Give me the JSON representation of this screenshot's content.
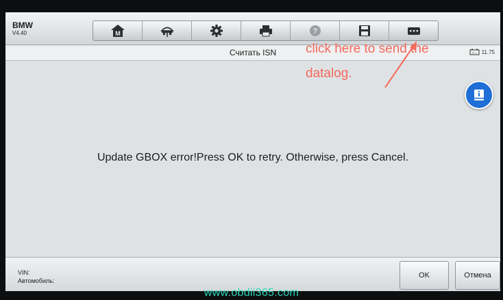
{
  "header": {
    "brand": "BMW",
    "version": "V4.40"
  },
  "toolbar": {
    "buttons": [
      {
        "name": "home",
        "icon": "home-m-icon"
      },
      {
        "name": "vehicle",
        "icon": "car-lift-icon"
      },
      {
        "name": "settings",
        "icon": "gear-icon"
      },
      {
        "name": "print",
        "icon": "printer-icon"
      },
      {
        "name": "help",
        "icon": "help-icon"
      },
      {
        "name": "save",
        "icon": "floppy-icon"
      },
      {
        "name": "datalog",
        "icon": "datalog-icon"
      }
    ]
  },
  "title_bar": {
    "title": "Считать ISN",
    "battery_text": "11.75"
  },
  "main": {
    "message": "Update GBOX error!Press OK to retry. Otherwise, press Cancel."
  },
  "annotation": {
    "line1": "click here to send the",
    "line2": "datalog."
  },
  "footer": {
    "vin_label": "VIN:",
    "vehicle_label": "Автомобиль:",
    "ok_label": "OK",
    "cancel_label": "Отмена"
  },
  "watermark": "www.obdii365.com",
  "colors": {
    "annotation": "#f46a5c",
    "watermark": "#2fd8b8",
    "float_button": "#1f6fd6"
  }
}
